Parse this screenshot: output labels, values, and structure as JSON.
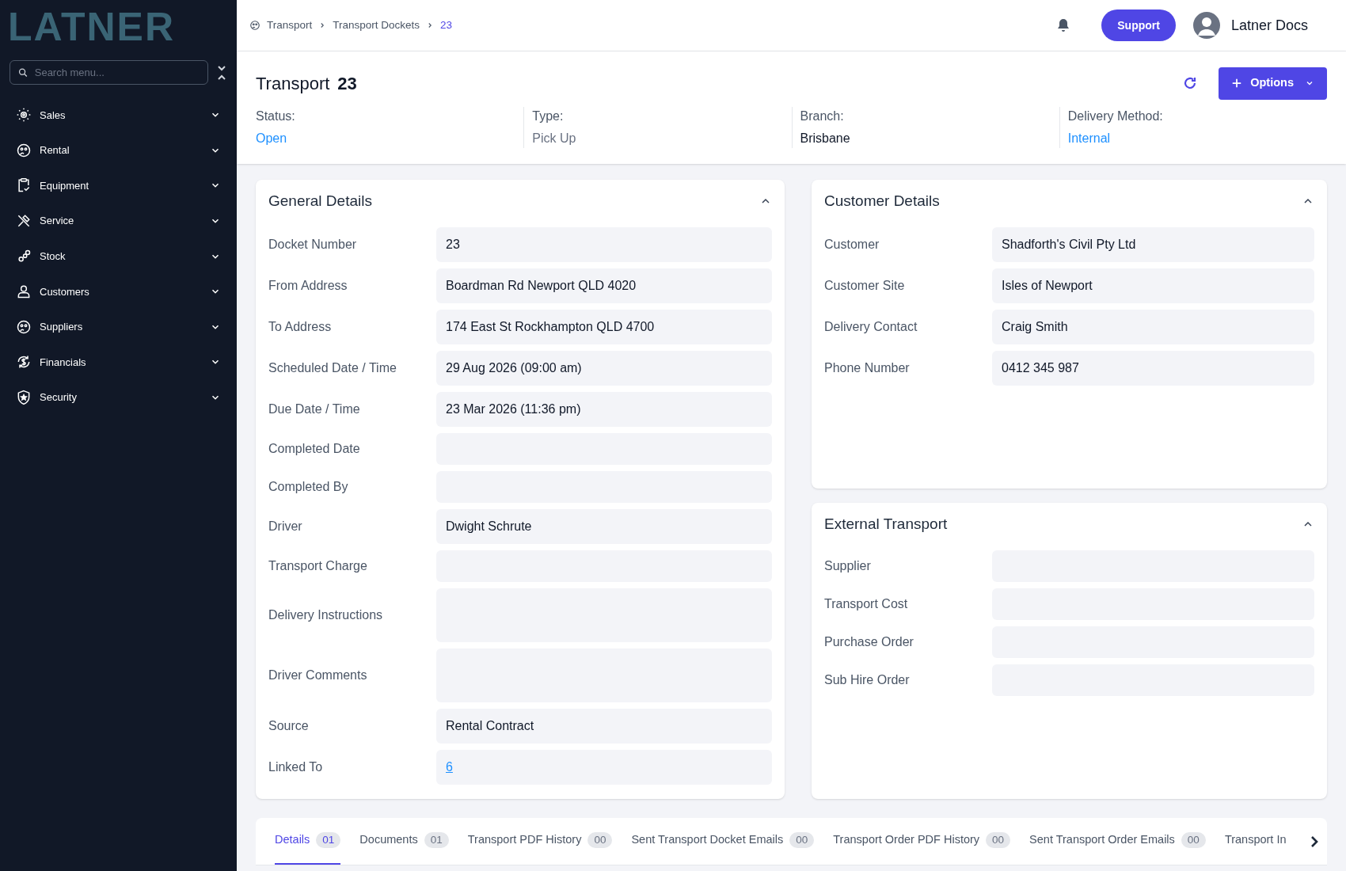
{
  "sidebar": {
    "logo": "LATNER",
    "search": {
      "placeholder": "Search menu..."
    },
    "items": [
      {
        "label": "Sales",
        "expanded": false
      },
      {
        "label": "Rental",
        "expanded": false
      },
      {
        "label": "Equipment",
        "expanded": false
      },
      {
        "label": "Service",
        "expanded": false
      },
      {
        "label": "Stock",
        "expanded": false
      },
      {
        "label": "Customers",
        "expanded": false
      },
      {
        "label": "Suppliers",
        "expanded": false
      },
      {
        "label": "Financials",
        "expanded": false
      },
      {
        "label": "Security",
        "expanded": false
      }
    ]
  },
  "topbar": {
    "breadcrumbs": [
      "Transport",
      "Transport Dockets",
      "23"
    ],
    "support": "Support",
    "user": "Latner Docs"
  },
  "header": {
    "title": "Transport",
    "number": "23",
    "options": "Options",
    "summary": [
      {
        "label": "Status:",
        "value": "Open",
        "kind": "link"
      },
      {
        "label": "Type:",
        "value": "Pick Up",
        "kind": "muted"
      },
      {
        "label": "Branch:",
        "value": "Brisbane",
        "kind": "plain"
      },
      {
        "label": "Delivery Method:",
        "value": "Internal",
        "kind": "link"
      }
    ]
  },
  "general": {
    "title": "General Details",
    "expanded": true,
    "fields": [
      {
        "label": "Docket Number",
        "value": "23"
      },
      {
        "label": "From Address",
        "value": "Boardman Rd Newport QLD 4020"
      },
      {
        "label": "To Address",
        "value": "174 East St Rockhampton QLD 4700"
      },
      {
        "label": "Scheduled Date / Time",
        "value": "29 Aug 2026 (09:00 am)"
      },
      {
        "label": "Due Date / Time",
        "value": "23 Mar 2026 (11:36 pm)"
      },
      {
        "label": "Completed Date",
        "kind": "empty"
      },
      {
        "label": "Completed By",
        "kind": "empty"
      },
      {
        "label": "Driver",
        "value": "Dwight Schrute"
      },
      {
        "label": "Transport Charge",
        "kind": "empty"
      },
      {
        "label": "Delivery Instructions",
        "kind": "area"
      },
      {
        "label": "Driver Comments",
        "kind": "area"
      },
      {
        "label": "Source",
        "value": "Rental Contract"
      },
      {
        "label": "Linked To",
        "value": "6",
        "kind": "link"
      }
    ]
  },
  "customer": {
    "title": "Customer Details",
    "expanded": true,
    "fields": [
      {
        "label": "Customer",
        "value": "Shadforth's Civil Pty Ltd"
      },
      {
        "label": "Customer Site",
        "value": "Isles of Newport"
      },
      {
        "label": "Delivery Contact",
        "value": "Craig Smith"
      },
      {
        "label": "Phone Number",
        "value": "0412 345 987"
      }
    ]
  },
  "external": {
    "title": "External Transport",
    "expanded": true,
    "fields": [
      {
        "label": "Supplier",
        "kind": "empty"
      },
      {
        "label": "Transport Cost",
        "kind": "empty"
      },
      {
        "label": "Purchase Order",
        "kind": "empty"
      },
      {
        "label": "Sub Hire Order",
        "kind": "empty"
      }
    ]
  },
  "tabs": [
    {
      "label": "Details",
      "count": "01",
      "selected": true
    },
    {
      "label": "Documents",
      "count": "01",
      "selected": false
    },
    {
      "label": "Transport PDF History",
      "count": "00",
      "selected": false
    },
    {
      "label": "Sent Transport Docket Emails",
      "count": "00",
      "selected": false
    },
    {
      "label": "Transport Order PDF History",
      "count": "00",
      "selected": false
    },
    {
      "label": "Sent Transport Order Emails",
      "count": "00",
      "selected": false
    },
    {
      "label": "Transport In",
      "selected": false
    }
  ]
}
